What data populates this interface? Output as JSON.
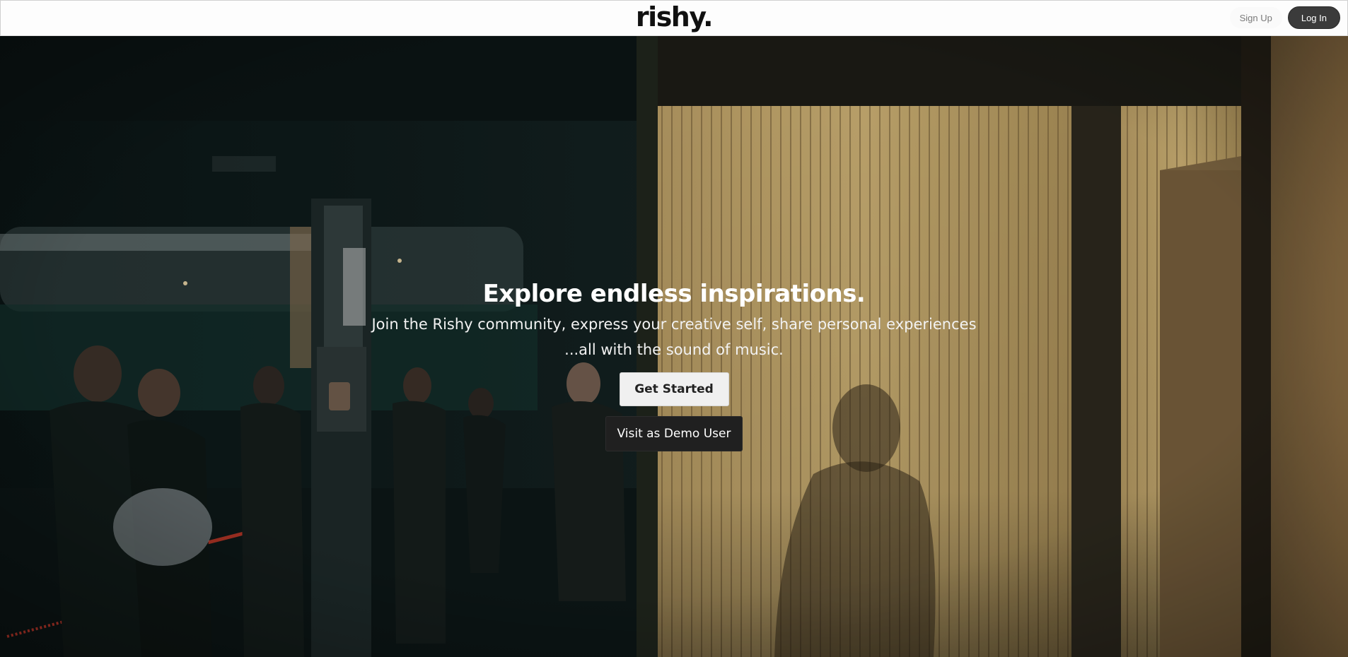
{
  "header": {
    "logo_text": "rishy.",
    "signup_label": "Sign Up",
    "login_label": "Log In"
  },
  "hero": {
    "title": "Explore endless inspirations.",
    "subtitle_line1": "Join the Rishy community, express your creative self, share personal experiences",
    "subtitle_line2": "...all with the sound of music.",
    "get_started_label": "Get Started",
    "demo_label": "Visit as Demo User"
  },
  "colors": {
    "navbar_bg": "#fdfdfd",
    "login_bg": "#3b3b3b",
    "get_started_bg": "#f0f0f0",
    "demo_bg": "#202020",
    "hero_text": "#ffffff"
  }
}
